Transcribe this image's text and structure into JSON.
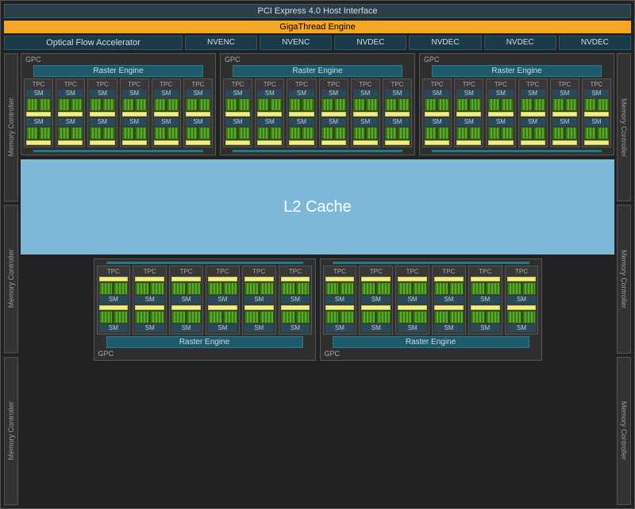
{
  "pci": "PCI Express 4.0 Host Interface",
  "giga": "GigaThread Engine",
  "ofa": "Optical Flow Accelerator",
  "encoders": [
    "NVENC",
    "NVENC",
    "NVDEC",
    "NVDEC",
    "NVDEC",
    "NVDEC"
  ],
  "mem": "Memory Controller",
  "gpc": "GPC",
  "raster": "Raster Engine",
  "tpc": "TPC",
  "sm": "SM",
  "l2": "L2 Cache",
  "layout": {
    "top_gpc_count": 3,
    "bottom_gpc_count": 2,
    "tpcs_per_gpc": 6,
    "sms_per_tpc": 2,
    "mem_controllers_per_side": 3
  }
}
